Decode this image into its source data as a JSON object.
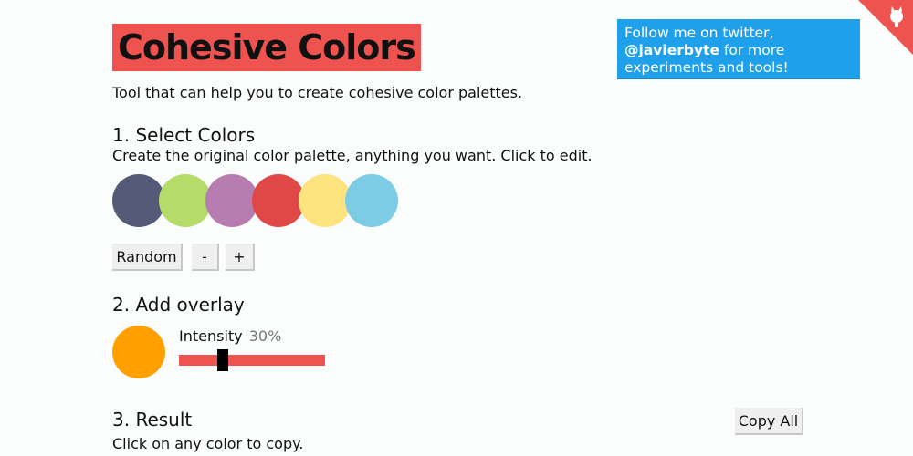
{
  "header": {
    "title": "Cohesive Colors",
    "subtitle": "Tool that can help you to create cohesive color palettes.",
    "title_bg": "#ef5350"
  },
  "twitter": {
    "line1": "Follow me on twitter,",
    "handle": "@javierbyte",
    "line2_rest": " for more",
    "line3": "experiments and tools!",
    "bg": "#1fa0ea"
  },
  "corner_icon": "github-cat-icon",
  "step1": {
    "heading": "1. Select Colors",
    "description": "Create the original color palette, anything you want. Click to edit.",
    "colors": [
      "#545a78",
      "#b5dc68",
      "#b77db0",
      "#e04848",
      "#fde47f",
      "#7ccce5"
    ],
    "random_label": "Random",
    "minus_label": "-",
    "plus_label": "+"
  },
  "step2": {
    "heading": "2. Add overlay",
    "overlay_color": "#ff9f00",
    "intensity_label": "Intensity",
    "intensity_value": "30%",
    "intensity_fraction": 0.3,
    "slider_color": "#ef5350"
  },
  "step3": {
    "heading": "3. Result",
    "description": "Click on any color to copy.",
    "copy_all_label": "Copy All"
  }
}
